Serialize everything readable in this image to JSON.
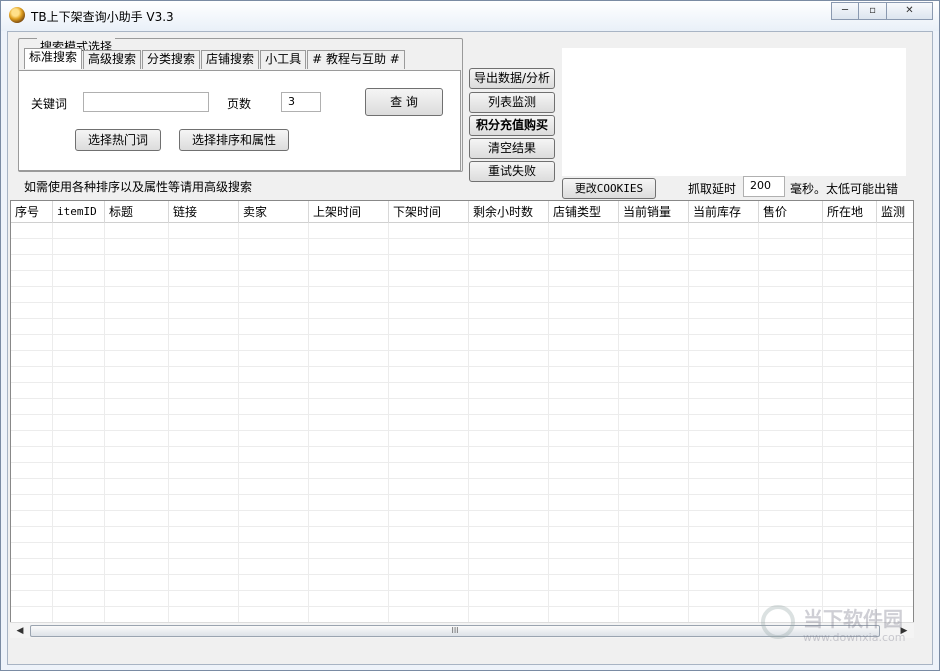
{
  "window": {
    "title": "TB上下架查询小助手 V3.3",
    "controls": [
      "─",
      "▫",
      "✕"
    ]
  },
  "search_group": {
    "label": "搜索模式选择",
    "tabs": [
      "标准搜索",
      "高级搜索",
      "分类搜索",
      "店铺搜索",
      "小工具",
      "# 教程与互助 #"
    ],
    "keyword_label": "关键词",
    "keyword_value": "",
    "pages_label": "页数",
    "pages_value": "3",
    "query_button": "查 询",
    "hot_words_button": "选择热门词",
    "sort_attr_button": "选择排序和属性"
  },
  "side_buttons": {
    "export": "导出数据/分析",
    "list_monitor": "列表监测",
    "points_recharge": "积分充值购买",
    "clear_results": "清空结果",
    "retry_failed": "重试失败"
  },
  "hint_text": "如需使用各种排序以及属性等请用高级搜索",
  "cookies_button": "更改COOKIES",
  "delay": {
    "label": "抓取延时",
    "value": "200",
    "suffix": "毫秒。太低可能出错"
  },
  "table": {
    "columns": [
      "序号",
      "itemID",
      "标题",
      "链接",
      "卖家",
      "上架时间",
      "下架时间",
      "剩余小时数",
      "店铺类型",
      "当前销量",
      "当前库存",
      "售价",
      "所在地",
      "监测"
    ],
    "rows": []
  },
  "scrollbar": {
    "left_arrow": "◀",
    "right_arrow": "▶",
    "thumb_grip": "III"
  },
  "watermark": {
    "title": "当下软件园",
    "url": "www.downxia.com"
  }
}
